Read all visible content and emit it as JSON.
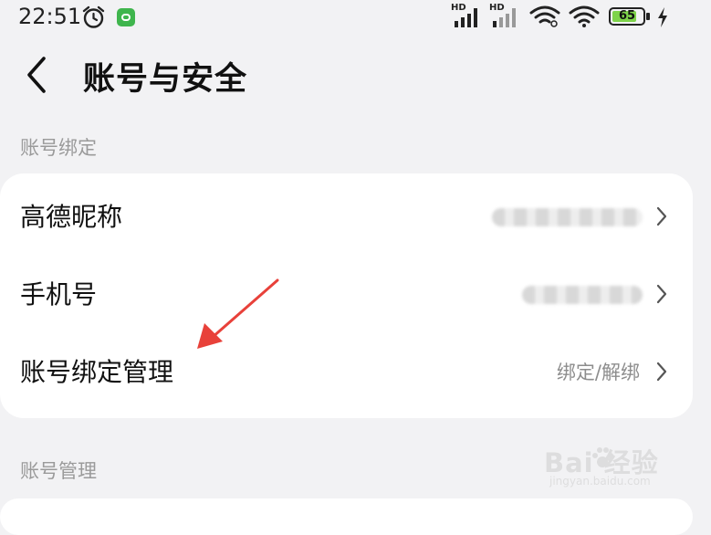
{
  "status_bar": {
    "time": "22:51",
    "signal1_label": "HD",
    "signal2_label": "HD",
    "battery_level": "65",
    "accent_battery": "#7ed34a"
  },
  "header": {
    "back_icon": "chevron-left-icon",
    "title": "账号与安全"
  },
  "sections": {
    "binding": {
      "label": "账号绑定",
      "rows": [
        {
          "label": "高德昵称",
          "value": ""
        },
        {
          "label": "手机号",
          "value": ""
        },
        {
          "label": "账号绑定管理",
          "value": "绑定/解绑"
        }
      ]
    },
    "management": {
      "label": "账号管理"
    }
  },
  "annotation": {
    "arrow_color": "#e8413a"
  },
  "watermark": {
    "text": "Bai 经验",
    "sub": "jingyan.baidu.com"
  }
}
